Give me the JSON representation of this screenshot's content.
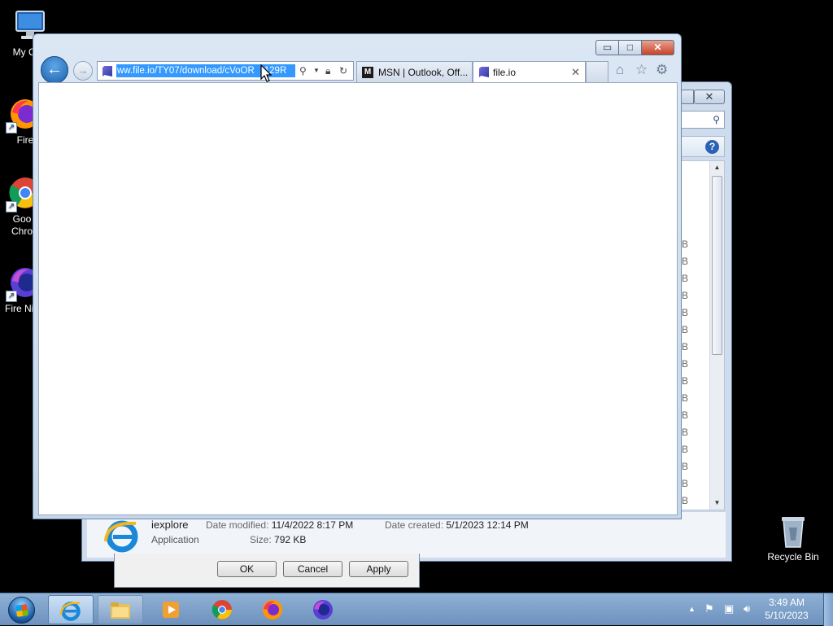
{
  "desktop": {
    "icons": [
      {
        "label": "My Com",
        "icon": "computer-icon"
      },
      {
        "label": "Fire",
        "icon": "firefox-icon"
      },
      {
        "label": "Goo Chro",
        "icon": "chrome-icon"
      },
      {
        "label": "Fire Nig",
        "icon": "firefox-nightly-icon"
      }
    ],
    "recycle_bin": "Recycle Bin"
  },
  "explorer": {
    "size_unit": "KB",
    "size_rows": 16,
    "details": {
      "name": "iexplore",
      "type": "Application",
      "date_modified_label": "Date modified:",
      "date_modified": "11/4/2022 8:17 PM",
      "size_label": "Size:",
      "size": "792 KB",
      "date_created_label": "Date created:",
      "date_created": "5/1/2023 12:14 PM"
    }
  },
  "properties_dialog": {
    "ok": "OK",
    "cancel": "Cancel",
    "apply": "Apply"
  },
  "ie": {
    "address": "ww.file.io/TY07/download/cVoOR",
    "address_tail": "129R",
    "tabs": [
      {
        "label": "MSN | Outlook, Off...",
        "active": false
      },
      {
        "label": "file.io",
        "active": true
      }
    ],
    "window_buttons": {
      "minimize": "▭",
      "maximize": "□",
      "close": "✕"
    }
  },
  "taskbar": {
    "items": [
      {
        "name": "internet-explorer",
        "active": true
      },
      {
        "name": "file-explorer",
        "active": false
      },
      {
        "name": "media-player",
        "active": false
      },
      {
        "name": "chrome",
        "active": false
      },
      {
        "name": "firefox",
        "active": false
      },
      {
        "name": "firefox-nightly",
        "active": false
      }
    ],
    "clock_time": "3:49 AM",
    "clock_date": "5/10/2023"
  },
  "colors": {
    "accent": "#3399ff",
    "taskbar": "#7fa3cc",
    "close": "#c7442a"
  }
}
